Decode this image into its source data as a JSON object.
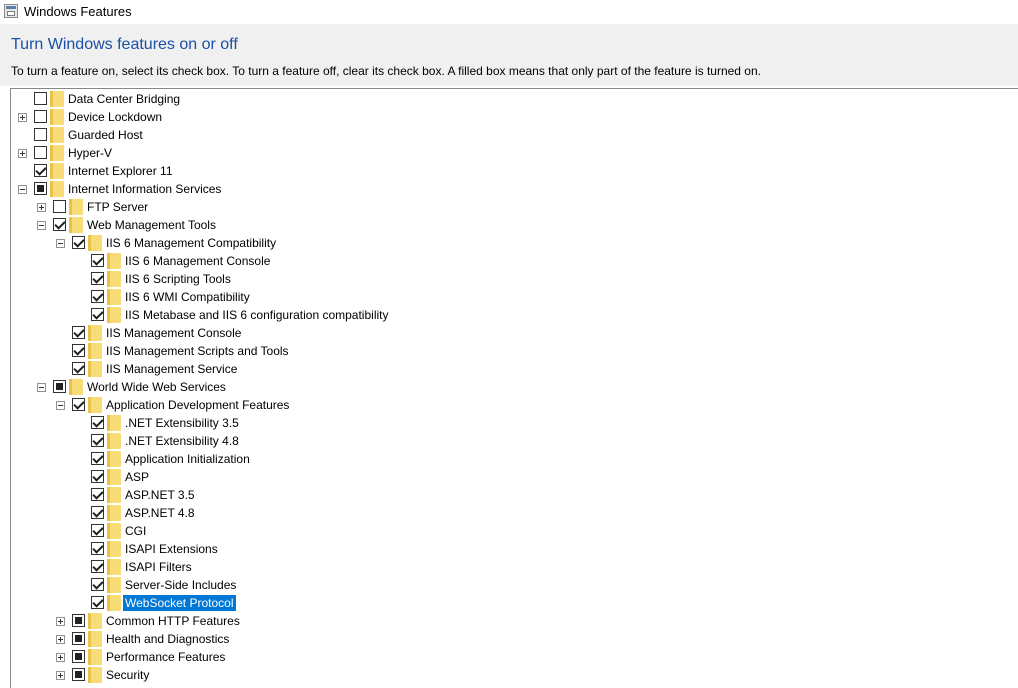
{
  "window": {
    "title": "Windows Features"
  },
  "header": {
    "heading": "Turn Windows features on or off",
    "instructions": "To turn a feature on, select its check box. To turn a feature off, clear its check box. A filled box means that only part of the feature is turned on."
  },
  "colors": {
    "heading": "#1a50a5",
    "selection": "#0078d7",
    "folder": "#f8dc77"
  },
  "tree": [
    {
      "label": "Data Center Bridging",
      "level": 0,
      "expander": "none",
      "state": "unchecked"
    },
    {
      "label": "Device Lockdown",
      "level": 0,
      "expander": "plus",
      "state": "unchecked"
    },
    {
      "label": "Guarded Host",
      "level": 0,
      "expander": "none",
      "state": "unchecked"
    },
    {
      "label": "Hyper-V",
      "level": 0,
      "expander": "plus",
      "state": "unchecked"
    },
    {
      "label": "Internet Explorer 11",
      "level": 0,
      "expander": "none",
      "state": "checked"
    },
    {
      "label": "Internet Information Services",
      "level": 0,
      "expander": "minus",
      "state": "partial"
    },
    {
      "label": "FTP Server",
      "level": 1,
      "expander": "plus",
      "state": "unchecked"
    },
    {
      "label": "Web Management Tools",
      "level": 1,
      "expander": "minus",
      "state": "checked"
    },
    {
      "label": "IIS 6 Management Compatibility",
      "level": 2,
      "expander": "minus",
      "state": "checked"
    },
    {
      "label": "IIS 6 Management Console",
      "level": 3,
      "expander": "none",
      "state": "checked"
    },
    {
      "label": "IIS 6 Scripting Tools",
      "level": 3,
      "expander": "none",
      "state": "checked"
    },
    {
      "label": "IIS 6 WMI Compatibility",
      "level": 3,
      "expander": "none",
      "state": "checked"
    },
    {
      "label": "IIS Metabase and IIS 6 configuration compatibility",
      "level": 3,
      "expander": "none",
      "state": "checked"
    },
    {
      "label": "IIS Management Console",
      "level": 2,
      "expander": "none",
      "state": "checked"
    },
    {
      "label": "IIS Management Scripts and Tools",
      "level": 2,
      "expander": "none",
      "state": "checked"
    },
    {
      "label": "IIS Management Service",
      "level": 2,
      "expander": "none",
      "state": "checked"
    },
    {
      "label": "World Wide Web Services",
      "level": 1,
      "expander": "minus",
      "state": "partial"
    },
    {
      "label": "Application Development Features",
      "level": 2,
      "expander": "minus",
      "state": "checked"
    },
    {
      "label": ".NET Extensibility 3.5",
      "level": 3,
      "expander": "none",
      "state": "checked"
    },
    {
      "label": ".NET Extensibility 4.8",
      "level": 3,
      "expander": "none",
      "state": "checked"
    },
    {
      "label": "Application Initialization",
      "level": 3,
      "expander": "none",
      "state": "checked"
    },
    {
      "label": "ASP",
      "level": 3,
      "expander": "none",
      "state": "checked"
    },
    {
      "label": "ASP.NET 3.5",
      "level": 3,
      "expander": "none",
      "state": "checked"
    },
    {
      "label": "ASP.NET 4.8",
      "level": 3,
      "expander": "none",
      "state": "checked"
    },
    {
      "label": "CGI",
      "level": 3,
      "expander": "none",
      "state": "checked"
    },
    {
      "label": "ISAPI Extensions",
      "level": 3,
      "expander": "none",
      "state": "checked"
    },
    {
      "label": "ISAPI Filters",
      "level": 3,
      "expander": "none",
      "state": "checked"
    },
    {
      "label": "Server-Side Includes",
      "level": 3,
      "expander": "none",
      "state": "checked"
    },
    {
      "label": "WebSocket Protocol",
      "level": 3,
      "expander": "none",
      "state": "checked",
      "selected": true
    },
    {
      "label": "Common HTTP Features",
      "level": 2,
      "expander": "plus",
      "state": "partial"
    },
    {
      "label": "Health and Diagnostics",
      "level": 2,
      "expander": "plus",
      "state": "partial"
    },
    {
      "label": "Performance Features",
      "level": 2,
      "expander": "plus",
      "state": "partial"
    },
    {
      "label": "Security",
      "level": 2,
      "expander": "plus",
      "state": "partial"
    }
  ]
}
